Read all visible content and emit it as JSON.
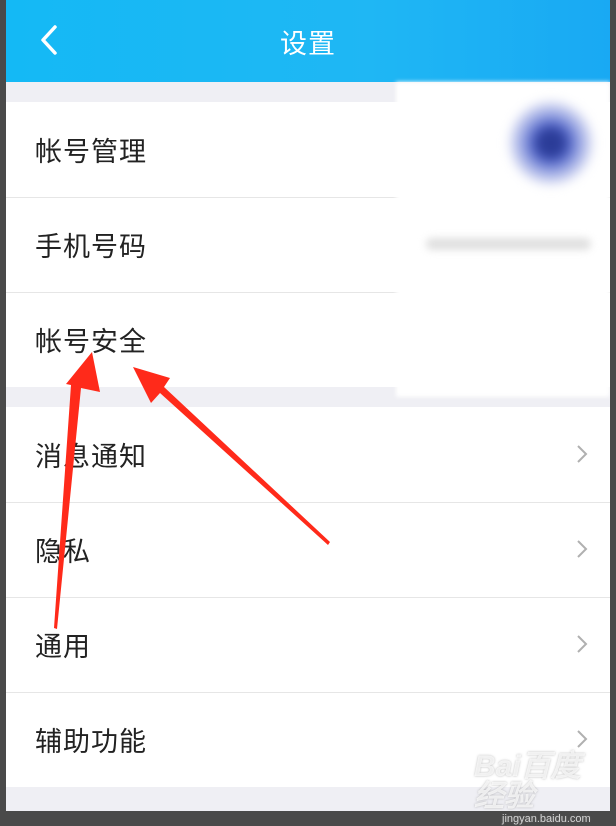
{
  "header": {
    "title": "设置"
  },
  "groups": [
    {
      "items": [
        {
          "label": "帐号管理"
        },
        {
          "label": "手机号码"
        },
        {
          "label": "帐号安全"
        }
      ]
    },
    {
      "items": [
        {
          "label": "消息通知"
        },
        {
          "label": "隐私"
        },
        {
          "label": "通用"
        },
        {
          "label": "辅助功能"
        }
      ]
    }
  ],
  "watermark": {
    "logo": "Bai百度 经验",
    "url": "jingyan.baidu.com"
  },
  "colors": {
    "header": "#1fb7f4",
    "arrow": "#ff2a1a",
    "background": "#efeff4"
  }
}
